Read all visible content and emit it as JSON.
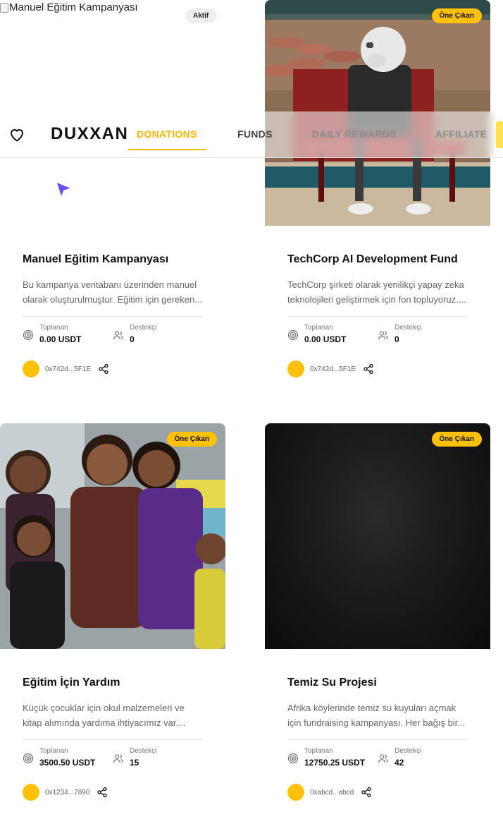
{
  "nav": {
    "brand": "DUXXAN",
    "tabs": [
      {
        "label": "DONATIONS",
        "active": true
      },
      {
        "label": "FUNDS",
        "active": false
      },
      {
        "label": "DAILY REWARDS",
        "active": false
      },
      {
        "label": "AFFILIATE",
        "active": false
      }
    ],
    "accent_color": "#f5b800"
  },
  "labels": {
    "raised": "Toplanan",
    "supporters": "Destekçi",
    "featured": "Öne Çıkan",
    "active": "Aktif"
  },
  "campaigns": [
    {
      "image_alt": "Manuel Eğitim Kampanyası",
      "status_badge": "Aktif",
      "title": "Manuel Eğitim Kampanyası",
      "description": "Bu kampanya veritabanı üzerinden manuel olarak oluşturulmuştur. Eğitim için gereken...",
      "raised": "0.00 USDT",
      "supporters": "0",
      "owner": "0x742d...5F1E"
    },
    {
      "image_alt": "robot sitting on a red bench",
      "badge": "Öne Çıkan",
      "title": "TechCorp AI Development Fund",
      "description": "TechCorp şirketi olarak yenilikçi yapay zeka teknolojileri geliştirmek için fon topluyoruz....",
      "raised": "0.00 USDT",
      "supporters": "0",
      "owner": "0x742d...5F1E"
    },
    {
      "image_alt": "smiling children",
      "badge": "Öne Çıkan",
      "title": "Eğitim İçin Yardım",
      "description": "Küçük çocuklar için okul malzemeleri ve kitap alımında yardıma ihtiyacımız var....",
      "raised": "3500.50 USDT",
      "supporters": "15",
      "owner": "0x1234...7890"
    },
    {
      "image_alt": "dark textured background",
      "badge": "Öne Çıkan",
      "title": "Temiz Su Projesi",
      "description": "Afrika köylerinde temiz su kuyuları açmak için fundraising kampanyası. Her bağış bir...",
      "raised": "12750.25 USDT",
      "supporters": "42",
      "owner": "0xabcd...abcd"
    }
  ],
  "icons": {
    "favorite": "heart-icon",
    "raised": "target-icon",
    "supporters": "users-icon",
    "share": "share-icon",
    "pointer": "cursor-icon"
  },
  "colors": {
    "badge": "#ffc107",
    "avatar": "#ffc107",
    "cursor": "#6c4cf5"
  }
}
